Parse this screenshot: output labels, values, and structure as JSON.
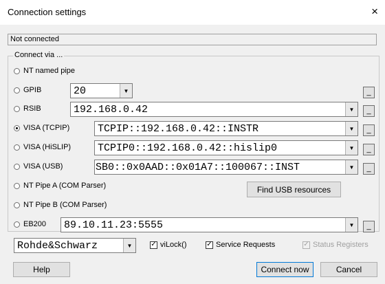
{
  "window": {
    "title": "Connection settings",
    "close_glyph": "×"
  },
  "status_text": "Not connected",
  "group_label": "Connect via ...",
  "options": [
    {
      "label": "NT named pipe",
      "selected": false
    },
    {
      "label": "GPIB",
      "selected": false,
      "value": "20"
    },
    {
      "label": "RSIB",
      "selected": false,
      "value": "192.168.0.42"
    },
    {
      "label": "VISA (TCPIP)",
      "selected": true,
      "value": "TCPIP::192.168.0.42::INSTR"
    },
    {
      "label": "VISA (HiSLIP)",
      "selected": false,
      "value": "TCPIP0::192.168.0.42::hislip0"
    },
    {
      "label": "VISA (USB)",
      "selected": false,
      "value": "SB0::0x0AAD::0x01A7::100067::INST"
    },
    {
      "label": "NT Pipe A (COM Parser)",
      "selected": false
    },
    {
      "label": "NT Pipe B (COM Parser)",
      "selected": false
    },
    {
      "label": "EB200",
      "selected": false,
      "value": "89.10.11.23:5555"
    }
  ],
  "small_button_glyph": "_",
  "find_usb_label": "Find USB resources",
  "vendor_value": "Rohde&Schwarz",
  "checks": [
    {
      "label": "viLock()",
      "checked": true,
      "disabled": false
    },
    {
      "label": "Service Requests",
      "checked": true,
      "disabled": false
    },
    {
      "label": "Status Registers",
      "checked": true,
      "disabled": true
    }
  ],
  "buttons": {
    "help": "Help",
    "connect": "Connect now",
    "cancel": "Cancel"
  },
  "icons": {
    "dropdown": "chevron-down-icon",
    "check": "check-icon"
  }
}
